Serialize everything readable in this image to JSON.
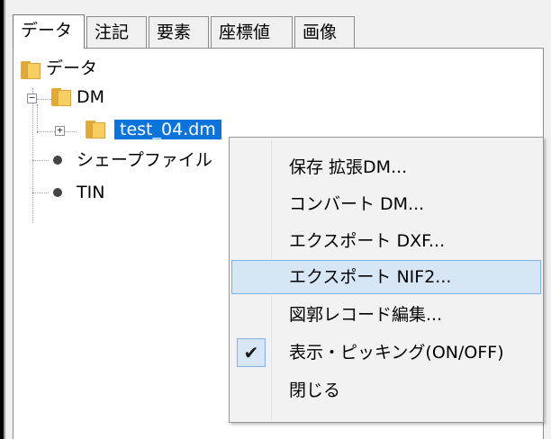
{
  "tabs": [
    "データ",
    "注記",
    "要素",
    "座標値",
    "画像"
  ],
  "tree": {
    "root": "データ",
    "dm": "DM",
    "dm_child": "test_04.dm",
    "shape": "シェープファイル",
    "tin": "TIN"
  },
  "context_menu": {
    "items": [
      "保存 拡張DM...",
      "コンバート DM...",
      "エクスポート DXF...",
      "エクスポート NIF2...",
      "図郭レコード編集...",
      "表示・ピッキング(ON/OFF)",
      "閉じる"
    ],
    "checkmark": "✔"
  },
  "colors": {
    "selection": "#0a74da",
    "menu_hover": "#d6e6f5",
    "menu_hover_border": "#7eb4ea"
  },
  "icons": {
    "folder": "folder-icon",
    "dot": "bullet-icon",
    "expander": "expander-plus-minus-icon",
    "check": "checkmark-icon"
  }
}
